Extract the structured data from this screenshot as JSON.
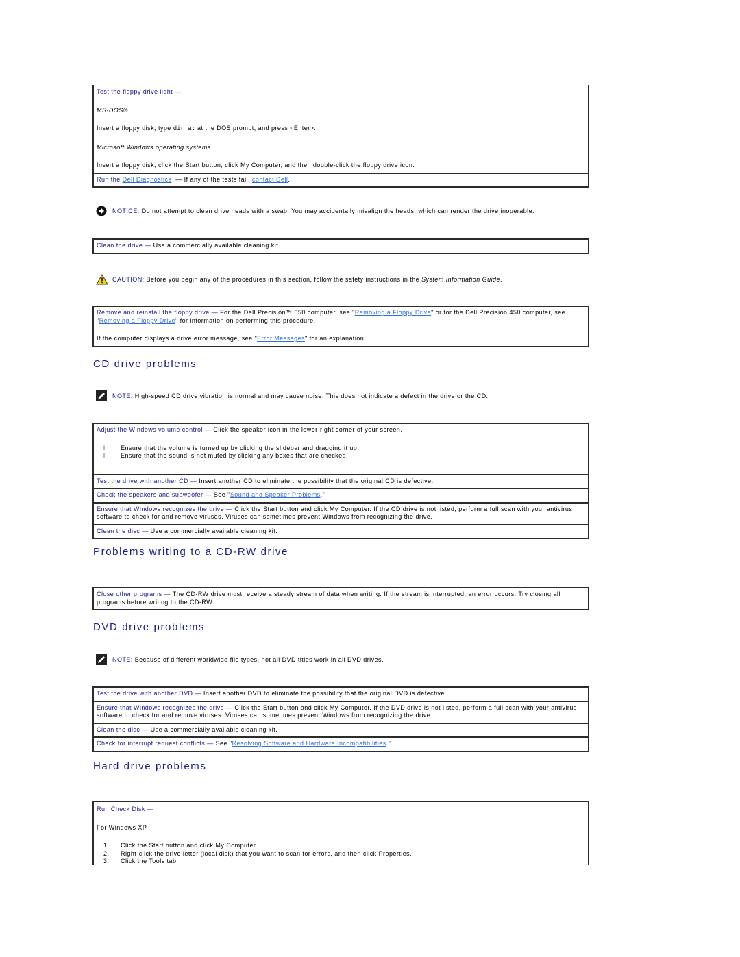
{
  "floppy": {
    "box1": {
      "term": "Test the floppy drive light —",
      "msdos_heading": "MS-DOS®",
      "msdos_pre": "Insert a floppy disk, type ",
      "msdos_cmd": "dir a:",
      "msdos_post": " at the DOS prompt, and press <Enter>.",
      "windows_heading": "Microsoft Windows operating systems",
      "windows_text": "Insert a floppy disk, click the Start button, click My Computer, and then double-click the floppy drive icon."
    },
    "box2": {
      "term_pre": "Run the ",
      "link1": "Dell Diagnostics",
      "mid": " — If any of the tests fail, ",
      "link2": "contact Dell",
      "post": "."
    },
    "notice": {
      "label": "NOTICE:",
      "text": " Do not attempt to clean drive heads with a swab. You may accidentally misalign the heads, which can render the drive inoperable."
    },
    "clean": {
      "term": "Clean the drive —",
      "text": " Use a commercially available cleaning kit."
    },
    "caution": {
      "label": "CAUTION:",
      "text": " Before you begin any of the procedures in this section, follow the safety instructions in the ",
      "guide": "System Information Guide",
      "end": "."
    },
    "reinstall": {
      "term": "Remove and reinstall the floppy drive —",
      "text1": " For the Dell Precision™ 650 computer, see \"",
      "link1": "Removing a Floppy Drive",
      "text2": "\" or for the Dell Precision 450 computer, see \"",
      "link2": "Removing a Floppy Drive",
      "text3": "\" for information on performing this procedure.",
      "err_pre": "If the computer displays a drive error message, see \"",
      "err_link": "Error Messages",
      "err_post": "\" for an explanation."
    }
  },
  "cd": {
    "heading": "CD drive problems",
    "note": {
      "label": "NOTE:",
      "text": " High-speed CD drive vibration is normal and may cause noise. This does not indicate a defect in the drive or the CD."
    },
    "rows": [
      {
        "term": "Adjust the Windows volume control —",
        "text": " Click the speaker icon in the lower-right corner of your screen.",
        "bullets": [
          "Ensure that the volume is turned up by clicking the slidebar and dragging it up.",
          "Ensure that the sound is not muted by clicking any boxes that are checked."
        ]
      },
      {
        "term": "Test the drive with another CD —",
        "text": " Insert another CD to eliminate the possibility that the original CD is defective."
      },
      {
        "term": "Check the speakers and subwoofer —",
        "text": " See \"",
        "link": "Sound and Speaker Problems",
        "post": ".\""
      },
      {
        "term": "Ensure that Windows recognizes the drive —",
        "text": " Click the Start button and click My Computer. If the CD drive is not listed, perform a full scan with your antivirus software to check for and remove viruses. Viruses can sometimes prevent Windows from recognizing the drive."
      },
      {
        "term": "Clean the disc —",
        "text": " Use a commercially available cleaning kit."
      }
    ]
  },
  "cdrw": {
    "heading": "Problems writing to a CD-RW drive",
    "row": {
      "term": "Close other programs —",
      "text": " The CD-RW drive must receive a steady stream of data when writing. If the stream is interrupted, an error occurs. Try closing all programs before writing to the CD-RW."
    }
  },
  "dvd": {
    "heading": "DVD drive problems",
    "note": {
      "label": "NOTE:",
      "text": " Because of different worldwide file types, not all DVD titles work in all DVD drives."
    },
    "rows": [
      {
        "term": "Test the drive with another DVD —",
        "text": " Insert another DVD to eliminate the possibility that the original DVD is defective."
      },
      {
        "term": "Ensure that Windows recognizes the drive —",
        "text": " Click the Start button and click My Computer. If the DVD drive is not listed, perform a full scan with your antivirus software to check for and remove viruses. Viruses can sometimes prevent Windows from recognizing the drive."
      },
      {
        "term": "Clean the disc —",
        "text": " Use a commercially available cleaning kit."
      },
      {
        "term": "Check for interrupt request conflicts —",
        "text": " See \"",
        "link": "Resolving Software and Hardware Incompatibilities",
        "post": ".\""
      }
    ]
  },
  "hdd": {
    "heading": "Hard drive problems",
    "term": "Run Check Disk —",
    "os": "For Windows XP",
    "steps": [
      {
        "n": "1.",
        "text": "Click the Start button and click My Computer."
      },
      {
        "n": "2.",
        "text": "Right-click the drive letter (local disk) that you want to scan for errors, and then click Properties."
      },
      {
        "n": "3.",
        "text": "Click the Tools tab."
      }
    ]
  },
  "icons": {
    "notice": "notice-arrow-icon",
    "caution": "caution-triangle-icon",
    "note": "note-pencil-icon",
    "bullet": "bullet-icon"
  },
  "colors": {
    "term": "#1a1a8c",
    "link": "#2f6fd6",
    "border": "#2b2b2b",
    "caution": "#f2d600"
  }
}
